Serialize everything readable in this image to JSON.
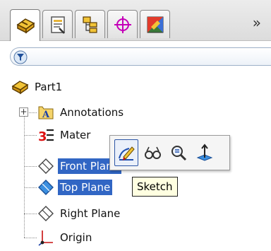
{
  "tabs": [
    {
      "name": "feature-manager",
      "icon": "part-icon",
      "active": true
    },
    {
      "name": "property-manager",
      "icon": "property-manager-icon",
      "active": false
    },
    {
      "name": "configuration-manager",
      "icon": "configuration-icon",
      "active": false
    },
    {
      "name": "dimxpert-manager",
      "icon": "dimxpert-icon",
      "active": false
    },
    {
      "name": "display-manager",
      "icon": "display-manager-icon",
      "active": false
    }
  ],
  "overflow_label": "»",
  "filter": {
    "icon": "filter-icon"
  },
  "tree": {
    "root": {
      "label": "Part1",
      "icon": "part-icon"
    },
    "items": [
      {
        "label": "Annotations",
        "icon": "annotations-icon",
        "expandable": true,
        "expand_symbol": "+"
      },
      {
        "label": "Mater",
        "icon": "material-icon"
      },
      {
        "label": "Front Plane",
        "icon": "plane-icon",
        "selected": true
      },
      {
        "label": "Top Plane",
        "icon": "plane-icon",
        "selected": true
      },
      {
        "label": "Right Plane",
        "icon": "plane-icon"
      },
      {
        "label": "Origin",
        "icon": "origin-icon"
      }
    ]
  },
  "context_toolbar": {
    "buttons": [
      {
        "name": "sketch",
        "icon": "sketch-icon",
        "hover": true
      },
      {
        "name": "hide-show",
        "icon": "glasses-icon"
      },
      {
        "name": "zoom-to-selection",
        "icon": "zoom-icon"
      },
      {
        "name": "normal-to",
        "icon": "normal-to-icon"
      }
    ]
  },
  "tooltip": {
    "text": "Sketch"
  },
  "colors": {
    "selection": "#3166c4",
    "tooltip_bg": "#ffffe1",
    "accent_blue": "#2d56a6"
  }
}
